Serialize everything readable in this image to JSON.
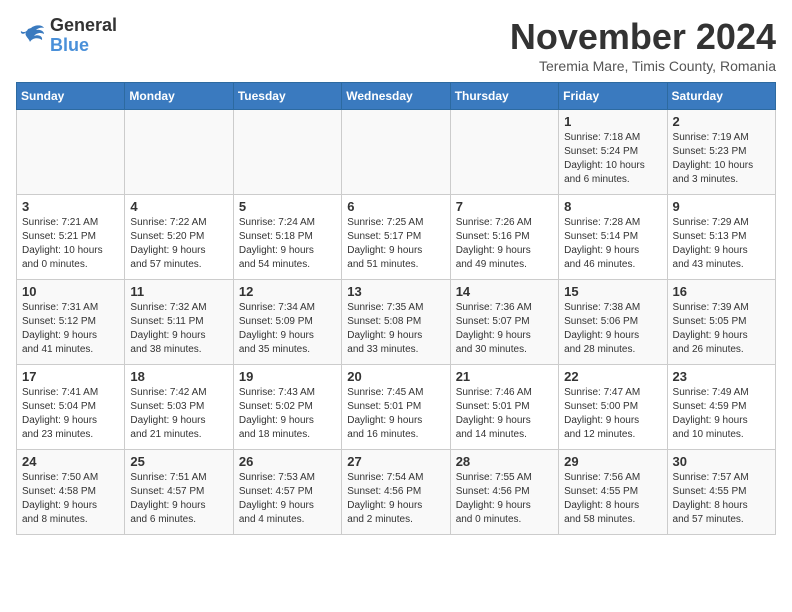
{
  "logo": {
    "line1": "General",
    "line2": "Blue"
  },
  "title": "November 2024",
  "subtitle": "Teremia Mare, Timis County, Romania",
  "weekdays": [
    "Sunday",
    "Monday",
    "Tuesday",
    "Wednesday",
    "Thursday",
    "Friday",
    "Saturday"
  ],
  "weeks": [
    [
      {
        "day": "",
        "info": ""
      },
      {
        "day": "",
        "info": ""
      },
      {
        "day": "",
        "info": ""
      },
      {
        "day": "",
        "info": ""
      },
      {
        "day": "",
        "info": ""
      },
      {
        "day": "1",
        "info": "Sunrise: 7:18 AM\nSunset: 5:24 PM\nDaylight: 10 hours\nand 6 minutes."
      },
      {
        "day": "2",
        "info": "Sunrise: 7:19 AM\nSunset: 5:23 PM\nDaylight: 10 hours\nand 3 minutes."
      }
    ],
    [
      {
        "day": "3",
        "info": "Sunrise: 7:21 AM\nSunset: 5:21 PM\nDaylight: 10 hours\nand 0 minutes."
      },
      {
        "day": "4",
        "info": "Sunrise: 7:22 AM\nSunset: 5:20 PM\nDaylight: 9 hours\nand 57 minutes."
      },
      {
        "day": "5",
        "info": "Sunrise: 7:24 AM\nSunset: 5:18 PM\nDaylight: 9 hours\nand 54 minutes."
      },
      {
        "day": "6",
        "info": "Sunrise: 7:25 AM\nSunset: 5:17 PM\nDaylight: 9 hours\nand 51 minutes."
      },
      {
        "day": "7",
        "info": "Sunrise: 7:26 AM\nSunset: 5:16 PM\nDaylight: 9 hours\nand 49 minutes."
      },
      {
        "day": "8",
        "info": "Sunrise: 7:28 AM\nSunset: 5:14 PM\nDaylight: 9 hours\nand 46 minutes."
      },
      {
        "day": "9",
        "info": "Sunrise: 7:29 AM\nSunset: 5:13 PM\nDaylight: 9 hours\nand 43 minutes."
      }
    ],
    [
      {
        "day": "10",
        "info": "Sunrise: 7:31 AM\nSunset: 5:12 PM\nDaylight: 9 hours\nand 41 minutes."
      },
      {
        "day": "11",
        "info": "Sunrise: 7:32 AM\nSunset: 5:11 PM\nDaylight: 9 hours\nand 38 minutes."
      },
      {
        "day": "12",
        "info": "Sunrise: 7:34 AM\nSunset: 5:09 PM\nDaylight: 9 hours\nand 35 minutes."
      },
      {
        "day": "13",
        "info": "Sunrise: 7:35 AM\nSunset: 5:08 PM\nDaylight: 9 hours\nand 33 minutes."
      },
      {
        "day": "14",
        "info": "Sunrise: 7:36 AM\nSunset: 5:07 PM\nDaylight: 9 hours\nand 30 minutes."
      },
      {
        "day": "15",
        "info": "Sunrise: 7:38 AM\nSunset: 5:06 PM\nDaylight: 9 hours\nand 28 minutes."
      },
      {
        "day": "16",
        "info": "Sunrise: 7:39 AM\nSunset: 5:05 PM\nDaylight: 9 hours\nand 26 minutes."
      }
    ],
    [
      {
        "day": "17",
        "info": "Sunrise: 7:41 AM\nSunset: 5:04 PM\nDaylight: 9 hours\nand 23 minutes."
      },
      {
        "day": "18",
        "info": "Sunrise: 7:42 AM\nSunset: 5:03 PM\nDaylight: 9 hours\nand 21 minutes."
      },
      {
        "day": "19",
        "info": "Sunrise: 7:43 AM\nSunset: 5:02 PM\nDaylight: 9 hours\nand 18 minutes."
      },
      {
        "day": "20",
        "info": "Sunrise: 7:45 AM\nSunset: 5:01 PM\nDaylight: 9 hours\nand 16 minutes."
      },
      {
        "day": "21",
        "info": "Sunrise: 7:46 AM\nSunset: 5:01 PM\nDaylight: 9 hours\nand 14 minutes."
      },
      {
        "day": "22",
        "info": "Sunrise: 7:47 AM\nSunset: 5:00 PM\nDaylight: 9 hours\nand 12 minutes."
      },
      {
        "day": "23",
        "info": "Sunrise: 7:49 AM\nSunset: 4:59 PM\nDaylight: 9 hours\nand 10 minutes."
      }
    ],
    [
      {
        "day": "24",
        "info": "Sunrise: 7:50 AM\nSunset: 4:58 PM\nDaylight: 9 hours\nand 8 minutes."
      },
      {
        "day": "25",
        "info": "Sunrise: 7:51 AM\nSunset: 4:57 PM\nDaylight: 9 hours\nand 6 minutes."
      },
      {
        "day": "26",
        "info": "Sunrise: 7:53 AM\nSunset: 4:57 PM\nDaylight: 9 hours\nand 4 minutes."
      },
      {
        "day": "27",
        "info": "Sunrise: 7:54 AM\nSunset: 4:56 PM\nDaylight: 9 hours\nand 2 minutes."
      },
      {
        "day": "28",
        "info": "Sunrise: 7:55 AM\nSunset: 4:56 PM\nDaylight: 9 hours\nand 0 minutes."
      },
      {
        "day": "29",
        "info": "Sunrise: 7:56 AM\nSunset: 4:55 PM\nDaylight: 8 hours\nand 58 minutes."
      },
      {
        "day": "30",
        "info": "Sunrise: 7:57 AM\nSunset: 4:55 PM\nDaylight: 8 hours\nand 57 minutes."
      }
    ]
  ]
}
